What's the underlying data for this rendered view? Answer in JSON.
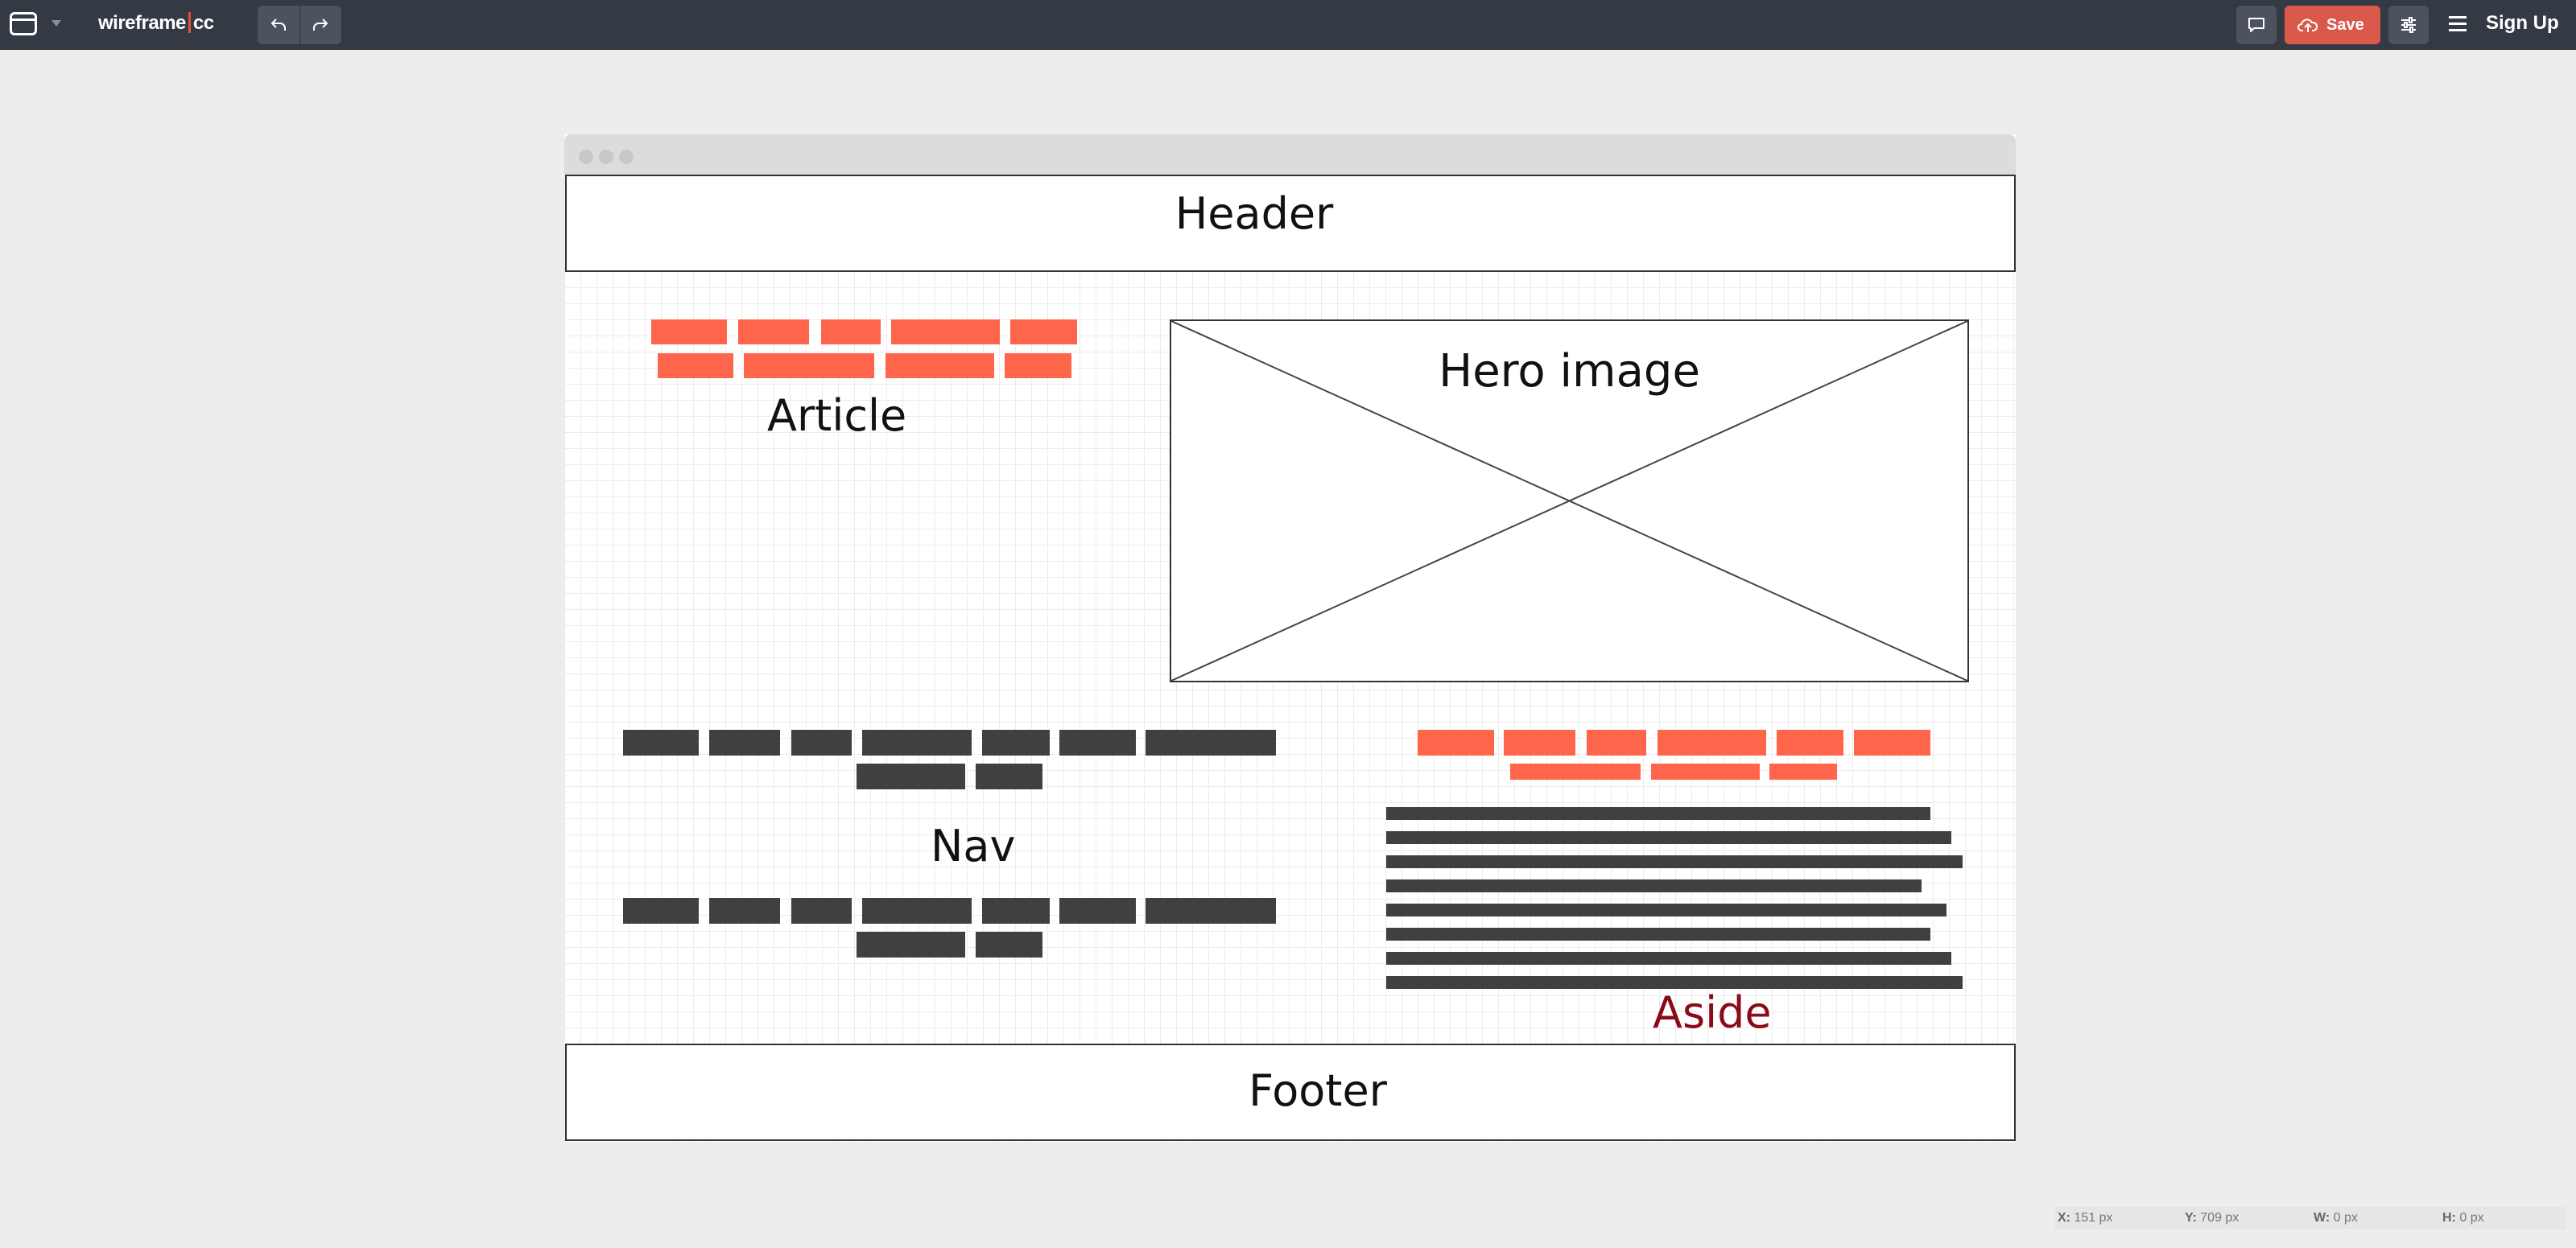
{
  "topbar": {
    "logo_left": "wireframe",
    "logo_right": "cc",
    "save_label": "Save",
    "signup_label": "Sign Up"
  },
  "canvas": {
    "header_label": "Header",
    "footer_label": "Footer",
    "hero_label": "Hero image",
    "article_label": "Article",
    "nav_label": "Nav",
    "aside_label": "Aside"
  },
  "colors": {
    "accent_orange": "#fe654a",
    "dark_block": "#404040",
    "aside_text": "#8b0a1a",
    "topbar_bg": "#343a44",
    "save_bg": "#d95a4a"
  },
  "status": {
    "x_label": "X:",
    "x_value": "151 px",
    "y_label": "Y:",
    "y_value": "709 px",
    "w_label": "W:",
    "w_value": "0 px",
    "h_label": "H:",
    "h_value": "0 px"
  }
}
